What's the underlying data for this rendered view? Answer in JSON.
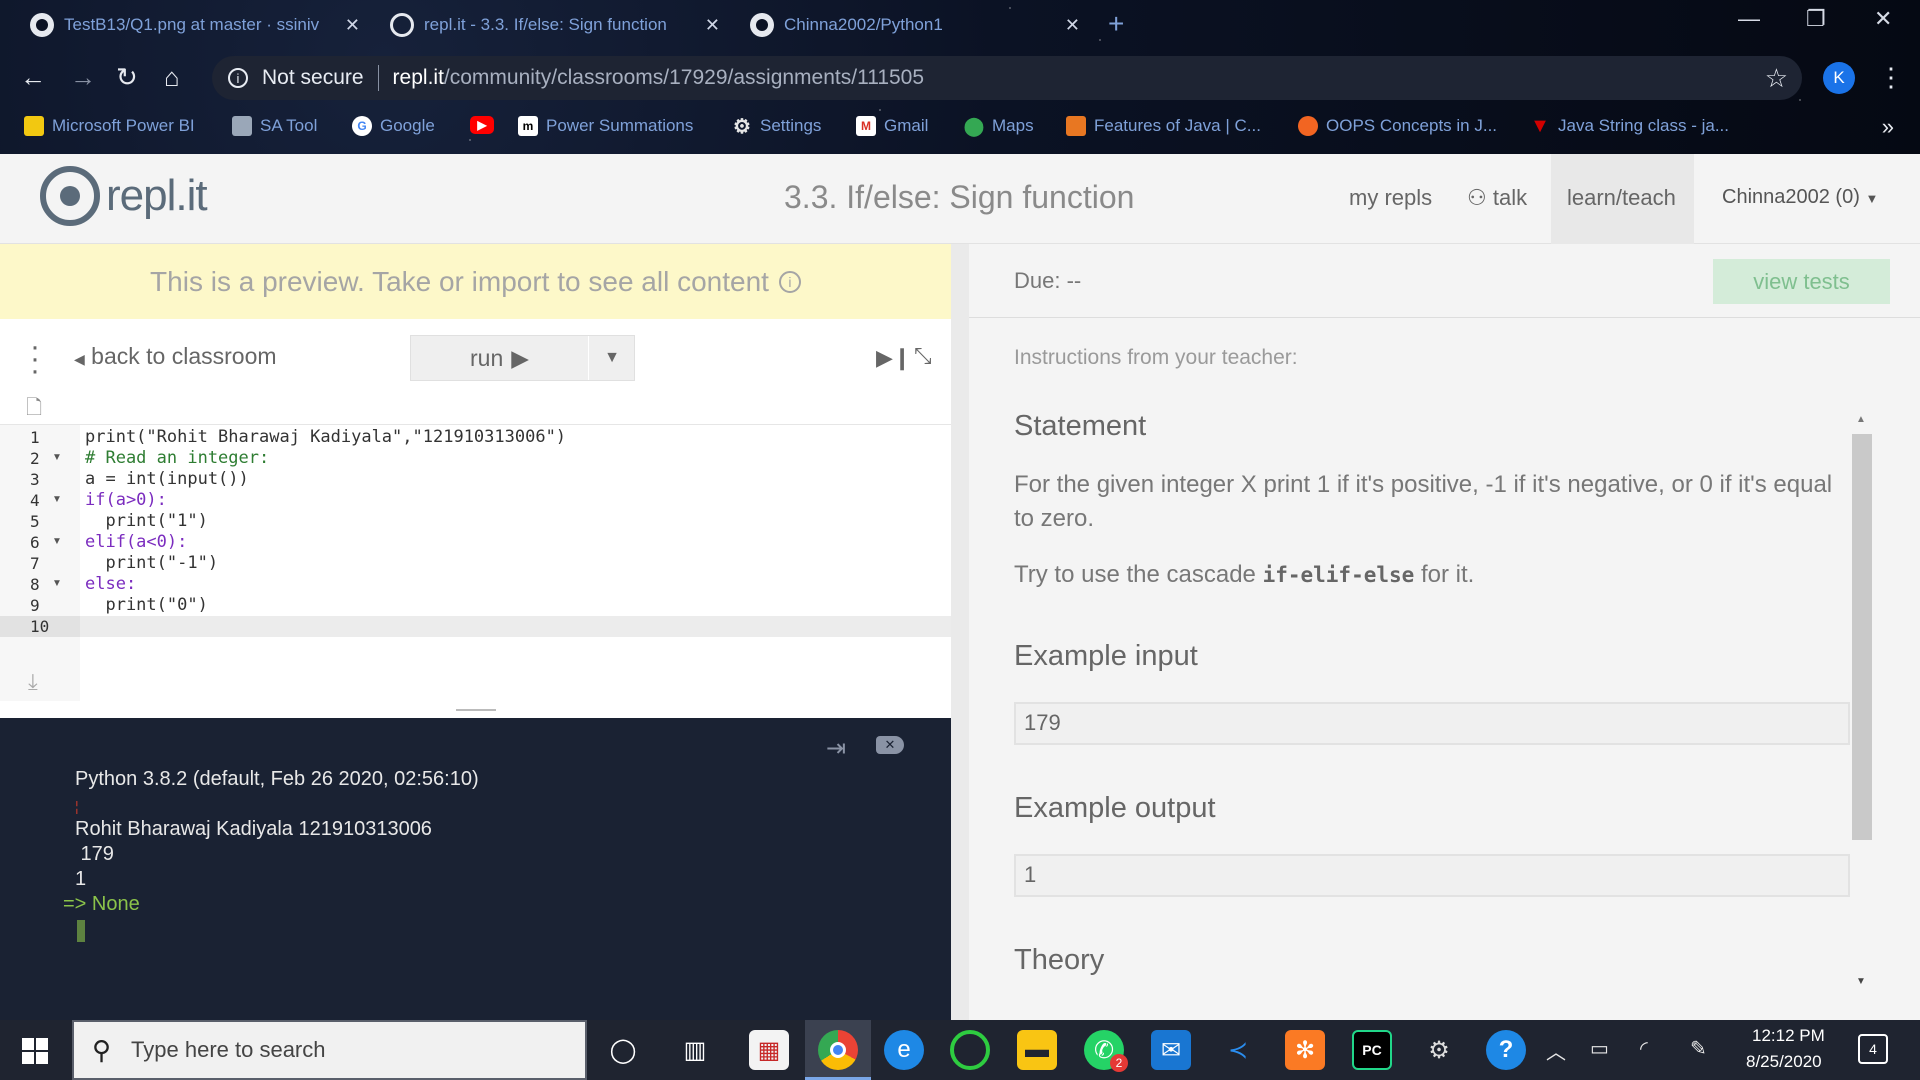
{
  "browser": {
    "tabs": [
      {
        "title": "TestB13/Q1.png at master · ssiniv",
        "icon": "github-icon"
      },
      {
        "title": "repl.it - 3.3. If/else: Sign function",
        "icon": "replit-icon"
      },
      {
        "title": "Chinna2002/Python1",
        "icon": "github-icon"
      }
    ],
    "new_tab_label": "+",
    "security_label": "Not secure",
    "url_host": "repl.it",
    "url_path": "/community/classrooms/17929/assignments/111505",
    "profile_initial": "K",
    "bookmarks": [
      {
        "label": "Microsoft Power BI",
        "color": "#f2c811"
      },
      {
        "label": "SA Tool",
        "color": "#9aa7b8"
      },
      {
        "label": "Google",
        "color": "#4285f4"
      },
      {
        "label": "",
        "color": "#ff0000"
      },
      {
        "label": "Power Summations",
        "color": "#ffffff"
      },
      {
        "label": "Settings",
        "color": "#e6e6e6"
      },
      {
        "label": "Gmail",
        "color": "#d93025"
      },
      {
        "label": "Maps",
        "color": "#34a853"
      },
      {
        "label": "Features of Java | C...",
        "color": "#e87722"
      },
      {
        "label": "OOPS Concepts in J...",
        "color": "#f26522"
      },
      {
        "label": "Java String class - ja...",
        "color": "#d10000"
      }
    ],
    "bookmarks_more": "»"
  },
  "header": {
    "logo_text": "repl.it",
    "title": "3.3. If/else: Sign function",
    "nav": {
      "my_repls": "my repls",
      "talk": "talk",
      "learn_teach": "learn/teach"
    },
    "user": "Chinna2002 (0)"
  },
  "left": {
    "preview_banner": "This is a preview. Take or import to see all content",
    "back_link": "back to classroom",
    "run_label": "run",
    "code_lines": [
      "print(\"Rohit Bharawaj Kadiyala\",\"121910313006\")",
      "# Read an integer:",
      "a = int(input())",
      "if(a>0):",
      "  print(\"1\")",
      "elif(a<0):",
      "  print(\"-1\")",
      "else:",
      "  print(\"0\")",
      ""
    ],
    "line_numbers": [
      "1",
      "2",
      "3",
      "4",
      "5",
      "6",
      "7",
      "8",
      "9",
      "10"
    ],
    "console": {
      "version_line": "Python 3.8.2 (default, Feb 26 2020, 02:56:10)",
      "output_line1": "Rohit Bharawaj Kadiyala 121910313006",
      "input_line": " 179",
      "output_line2": "1",
      "result_line": "=> None"
    }
  },
  "right": {
    "due": "Due: --",
    "view_tests": "view tests",
    "instructions_label": "Instructions from your teacher:",
    "statement_heading": "Statement",
    "statement_text_part1": "For the given integer X print 1 if it's positive, -1 if it's negative, or 0 if it's equal to zero.",
    "statement_text2_pre": "Try to use the cascade ",
    "statement_text2_code": "if-elif-else",
    "statement_text2_post": " for it.",
    "example_input_heading": "Example input",
    "example_input": "179",
    "example_output_heading": "Example output",
    "example_output": "1",
    "theory_heading": "Theory"
  },
  "taskbar": {
    "search_placeholder": "Type here to search",
    "time": "12:12 PM",
    "date": "8/25/2020",
    "notification_count": "4",
    "whatsapp_badge": "2"
  }
}
